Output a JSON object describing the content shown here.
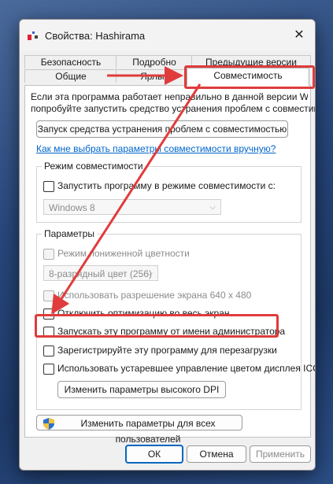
{
  "window": {
    "title": "Свойства: Hashirama",
    "close_glyph": "✕"
  },
  "tabs_back": [
    "Безопасность",
    "Подробно",
    "Предыдущие версии"
  ],
  "tabs_front": [
    "Общие",
    "Ярлык",
    "Совместимость"
  ],
  "intro": {
    "line1": "Если эта программа работает неправильно в данной версии Windows,",
    "line2": "попробуйте запустить средство устранения проблем с совместимостью."
  },
  "troubleshoot_button": "Запуск средства устранения проблем с совместимостью",
  "help_link": "Как мне выбрать параметры совместимости вручную?",
  "compat_mode": {
    "legend": "Режим совместимости",
    "checkbox": "Запустить программу в режиме совместимости с:",
    "select_value": "Windows 8"
  },
  "params": {
    "legend": "Параметры",
    "reduced_color": "Режим пониженной цветности",
    "color_select": "8-разрядный цвет (256)",
    "res_640": "Использовать разрешение экрана 640 x 480",
    "disable_fullscreen": "Отключить оптимизацию во весь экран",
    "run_as_admin": "Запускать эту программу от имени администратора",
    "register_restart": "Зарегистрируйте эту программу для перезагрузки",
    "legacy_icc": "Использовать устаревшее управление цветом дисплея ICC",
    "dpi_button": "Изменить параметры высокого DPI"
  },
  "all_users_button": "Изменить параметры для всех пользователей",
  "footer": {
    "ok": "ОК",
    "cancel": "Отмена",
    "apply": "Применить"
  },
  "colors": {
    "annotation": "#e03c3c",
    "accent": "#0067c0",
    "link": "#0066cc"
  }
}
